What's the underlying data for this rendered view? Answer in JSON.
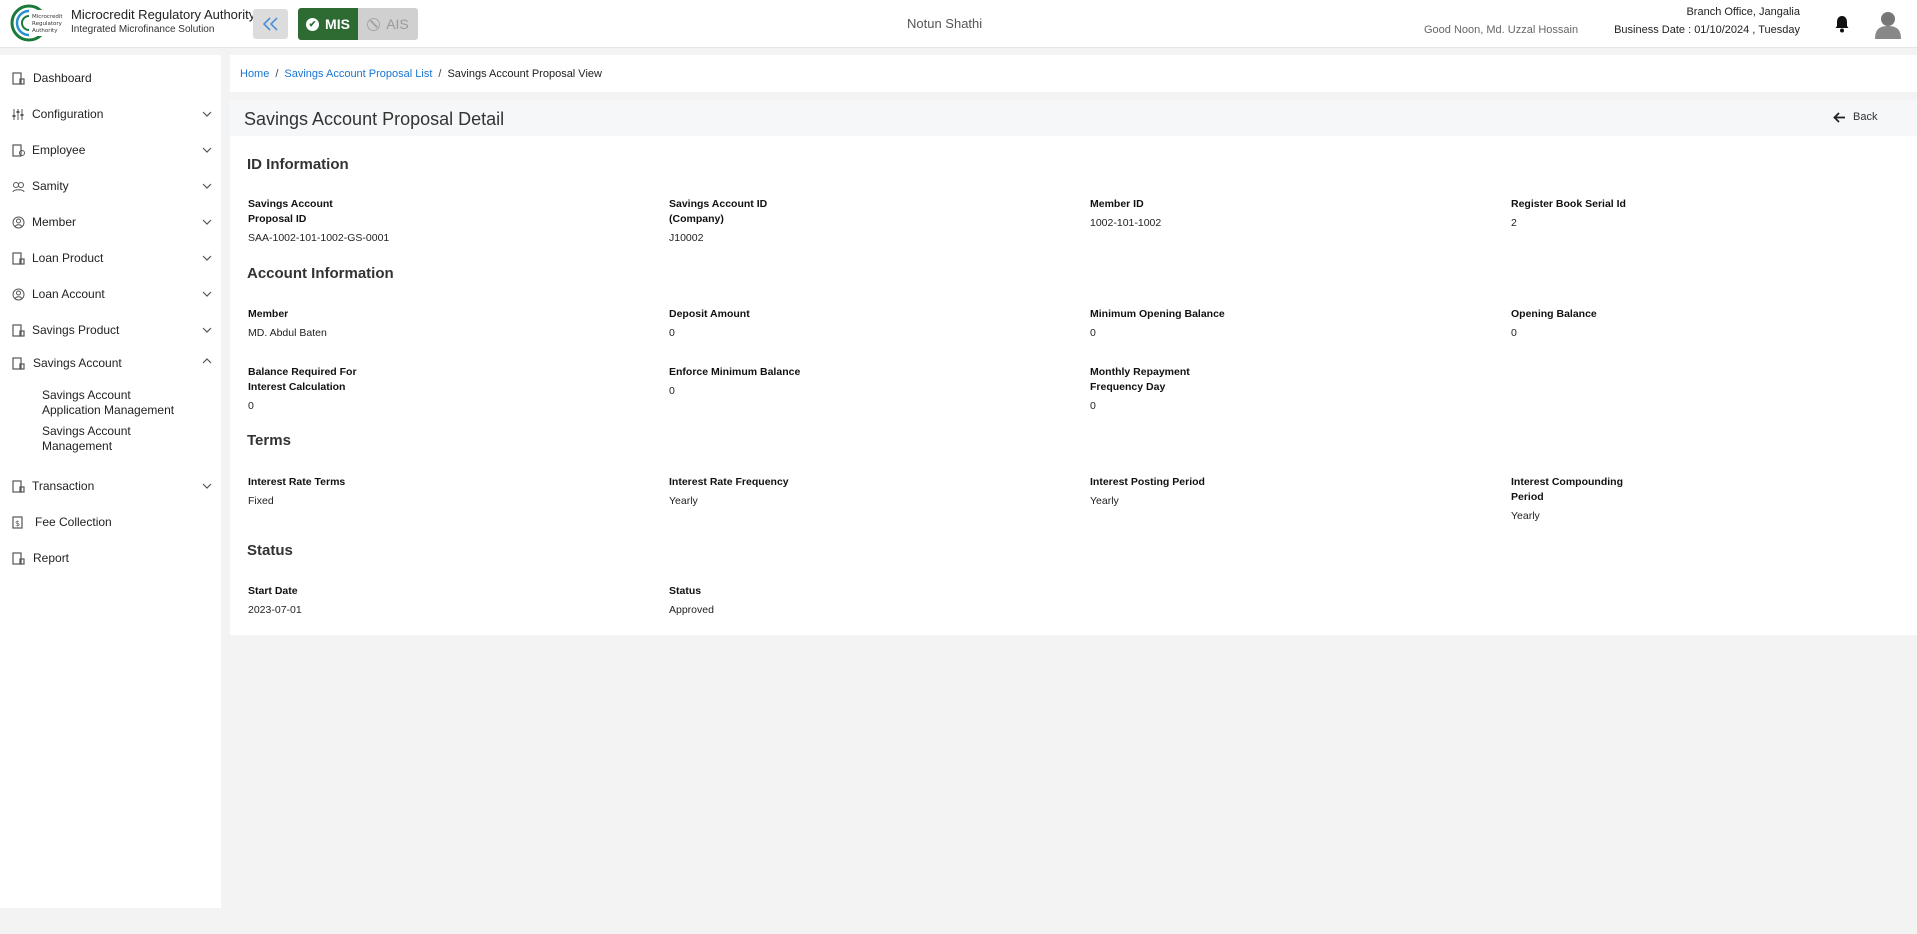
{
  "header": {
    "org_name": "Microcredit Regulatory Authority",
    "org_subtitle": "Integrated Microfinance Solution",
    "logo_text": "Microcredit Regulatory Authority",
    "mode_mis": "MIS",
    "mode_ais": "AIS",
    "app_name": "Notun Shathi",
    "greeting": "Good Noon, Md. Uzzal Hossain",
    "branch": "Branch Office, Jangalia",
    "business_date": "Business Date : 01/10/2024 , Tuesday"
  },
  "sidebar": {
    "items": [
      {
        "label": "Dashboard",
        "icon": "dashboard-icon",
        "expandable": false
      },
      {
        "label": "Configuration",
        "icon": "sliders-icon",
        "expandable": true
      },
      {
        "label": "Employee",
        "icon": "employee-icon",
        "expandable": true
      },
      {
        "label": "Samity",
        "icon": "samity-icon",
        "expandable": true
      },
      {
        "label": "Member",
        "icon": "member-icon",
        "expandable": true
      },
      {
        "label": "Loan Product",
        "icon": "document-icon",
        "expandable": true
      },
      {
        "label": "Loan Account",
        "icon": "member-icon",
        "expandable": true
      },
      {
        "label": "Savings Product",
        "icon": "document-icon",
        "expandable": true
      },
      {
        "label": "Savings Account",
        "icon": "document-icon",
        "expandable": true,
        "expanded": true
      },
      {
        "label": "Transaction",
        "icon": "document-icon",
        "expandable": true
      },
      {
        "label": "Fee Collection",
        "icon": "fee-icon",
        "expandable": false
      },
      {
        "label": "Report",
        "icon": "document-icon",
        "expandable": false
      }
    ],
    "savings_sub": [
      "Savings Account Application Management",
      "Savings Account Management"
    ]
  },
  "breadcrumb": {
    "home": "Home",
    "list": "Savings Account Proposal List",
    "current": "Savings Account Proposal View",
    "sep": "/"
  },
  "detail": {
    "title": "Savings Account Proposal Detail",
    "back_label": "Back",
    "sections": {
      "id_info": "ID Information",
      "account_info": "Account Information",
      "terms": "Terms",
      "status": "Status"
    },
    "fields": {
      "proposal_id": {
        "label": "Savings Account Proposal ID",
        "value": "SAA-1002-101-1002-GS-0001"
      },
      "account_id": {
        "label": "Savings Account ID (Company)",
        "value": "J10002"
      },
      "member_id": {
        "label": "Member ID",
        "value": "1002-101-1002"
      },
      "register_serial": {
        "label": "Register Book Serial Id",
        "value": "2"
      },
      "member": {
        "label": "Member",
        "value": "MD. Abdul Baten"
      },
      "deposit_amount": {
        "label": "Deposit Amount",
        "value": "0"
      },
      "min_opening_balance": {
        "label": "Minimum Opening Balance",
        "value": "0"
      },
      "opening_balance": {
        "label": "Opening Balance",
        "value": "0"
      },
      "balance_required": {
        "label": "Balance Required For Interest Calculation",
        "value": "0"
      },
      "enforce_min_balance": {
        "label": "Enforce Minimum Balance",
        "value": "0"
      },
      "monthly_repayment": {
        "label": "Monthly Repayment Frequency Day",
        "value": "0"
      },
      "interest_rate_terms": {
        "label": "Interest Rate Terms",
        "value": "Fixed"
      },
      "interest_rate_frequency": {
        "label": "Interest Rate Frequency",
        "value": "Yearly"
      },
      "interest_posting_period": {
        "label": "Interest Posting Period",
        "value": "Yearly"
      },
      "interest_compounding": {
        "label": "Interest Compounding Period",
        "value": "Yearly"
      },
      "start_date": {
        "label": "Start Date",
        "value": "2023-07-01"
      },
      "status": {
        "label": "Status",
        "value": "Approved"
      }
    }
  }
}
